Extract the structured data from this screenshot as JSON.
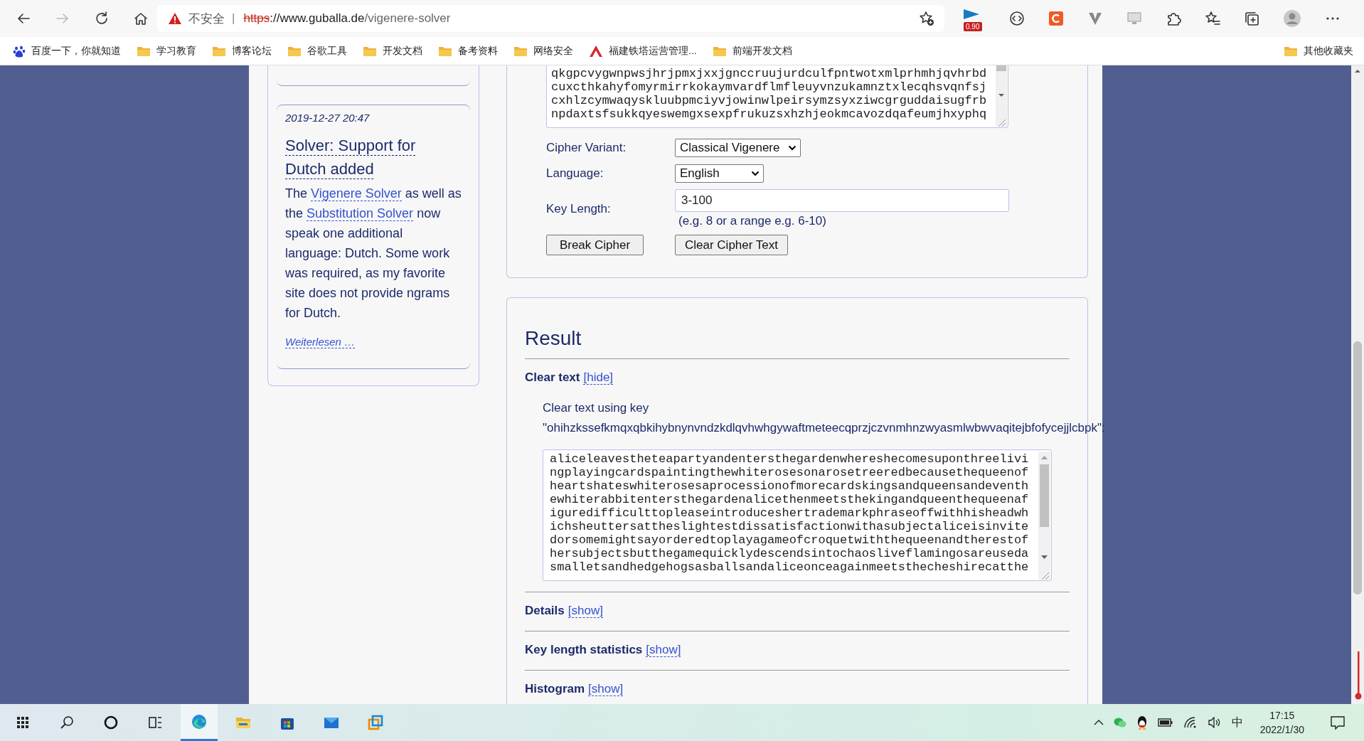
{
  "browser": {
    "insecure": true,
    "security_label": "不安全",
    "separator": "|",
    "url_scheme": "https",
    "url_host": "://www.guballa.de",
    "url_path": "/vigenere-solver",
    "extension_badge": "0.90"
  },
  "bookmarks": [
    {
      "kind": "baidu",
      "label": "百度一下，你就知道"
    },
    {
      "kind": "folder",
      "label": "学习教育"
    },
    {
      "kind": "folder",
      "label": "博客论坛"
    },
    {
      "kind": "folder",
      "label": "谷歌工具"
    },
    {
      "kind": "folder",
      "label": "开发文档"
    },
    {
      "kind": "folder",
      "label": "备考资料"
    },
    {
      "kind": "folder",
      "label": "网络安全"
    },
    {
      "kind": "site",
      "label": "福建铁塔运营管理..."
    },
    {
      "kind": "folder",
      "label": "前端开发文档"
    }
  ],
  "other_bookmarks": {
    "kind": "folder",
    "label": "其他收藏夹"
  },
  "sidebar": {
    "post": {
      "date": "2019-12-27 20:47",
      "title": "Solver: Support for Dutch added",
      "body": [
        {
          "text": "The ",
          "link": false
        },
        {
          "text": "Vigenere Solver",
          "link": true
        },
        {
          "text": " as well as the ",
          "link": false
        },
        {
          "text": "Substitution Solver",
          "link": true
        },
        {
          "text": " now speak one additional language: Dutch. Some work was required, as my favorite site does not provide ngrams for Dutch.",
          "link": false
        }
      ],
      "more": "Weiterlesen …"
    }
  },
  "cipher_text": {
    "lines": [
      "qkgpcvygwnpwsjhrjpmxjxxjgnccruujurdculfpntwotxmlprhmhjqvhrbd",
      "cuxcthkahyfomyrmirrkokaymvardflmfleuyvnzukamnztxlecqhsvqnfsj",
      "cxhlzcymwaqyskluubpmciyvjowinwlpeirsymzsyxziwcgrguddaisugfrb",
      "npdaxtsfsukkqyeswemgxsexpfrukuzsxhzhjeokmcavozdqafeumjhxyphq"
    ]
  },
  "form": {
    "variant": {
      "label": "Cipher Variant:",
      "value": "Classical Vigenere"
    },
    "language": {
      "label": "Language:",
      "value": "English"
    },
    "key_length": {
      "label": "Key Length:",
      "value": "3-100",
      "hint": "(e.g. 8 or a range e.g. 6-10)"
    },
    "buttons": [
      "Break Cipher",
      "Clear Cipher Text"
    ]
  },
  "result": {
    "title": "Result",
    "sections": [
      {
        "title": "Clear text",
        "toggle": "[hide]",
        "expanded": true,
        "caption": "Clear text using key",
        "key": "\"ohihzkssefkmqxqbkihybnynvndzkdlqvhwhgywaftmeteecqprzjczvnmhnzwyasmlwbwvaqitejbfofycejjlcbpk\":",
        "lines": [
          "aliceleavestheteapartyandentersthegardenwhereshecomesuponthreelivi",
          "ngplayingcardspaintingthewhiterosesonarosetreeredbecausethequeenof",
          "heartshateswhiterosesaprocessionofmorecardskingsandqueensandeventh",
          "ewhiterabbitentersthegardenalicethenmeetsthekingandqueenthequeenaf",
          "iguredifficulttopleaseintroduceshertrademarkphraseoffwithhisheadwh",
          "ichsheuttersattheslightestdissatisfactionwithasubjectaliceisinvite",
          "dorsomemightsayorderedtoplayagameofcroquetwiththequeenandtherestof",
          "hersubjectsbutthegamequicklydescendsintochaosliveflamingosareuseda",
          "smalletsandhedgehogsasballsandaliceonceagainmeetsthecheshirecatthe"
        ]
      },
      {
        "title": "Details",
        "toggle": "[show]",
        "expanded": false
      },
      {
        "title": "Key length statistics",
        "toggle": "[show]",
        "expanded": false
      },
      {
        "title": "Histogram",
        "toggle": "[show]",
        "expanded": false
      }
    ]
  },
  "taskbar": {
    "apps": [
      {
        "kind": "start",
        "selected": false
      },
      {
        "kind": "search",
        "selected": false
      },
      {
        "kind": "cortana",
        "selected": false
      },
      {
        "kind": "taskview",
        "selected": false
      },
      {
        "kind": "edge",
        "selected": true
      },
      {
        "kind": "explorer",
        "selected": false
      },
      {
        "kind": "store",
        "selected": false
      },
      {
        "kind": "mail",
        "selected": false
      },
      {
        "kind": "app",
        "selected": false
      }
    ],
    "ime": "中",
    "time": "17:15",
    "date": "2022/1/30"
  }
}
